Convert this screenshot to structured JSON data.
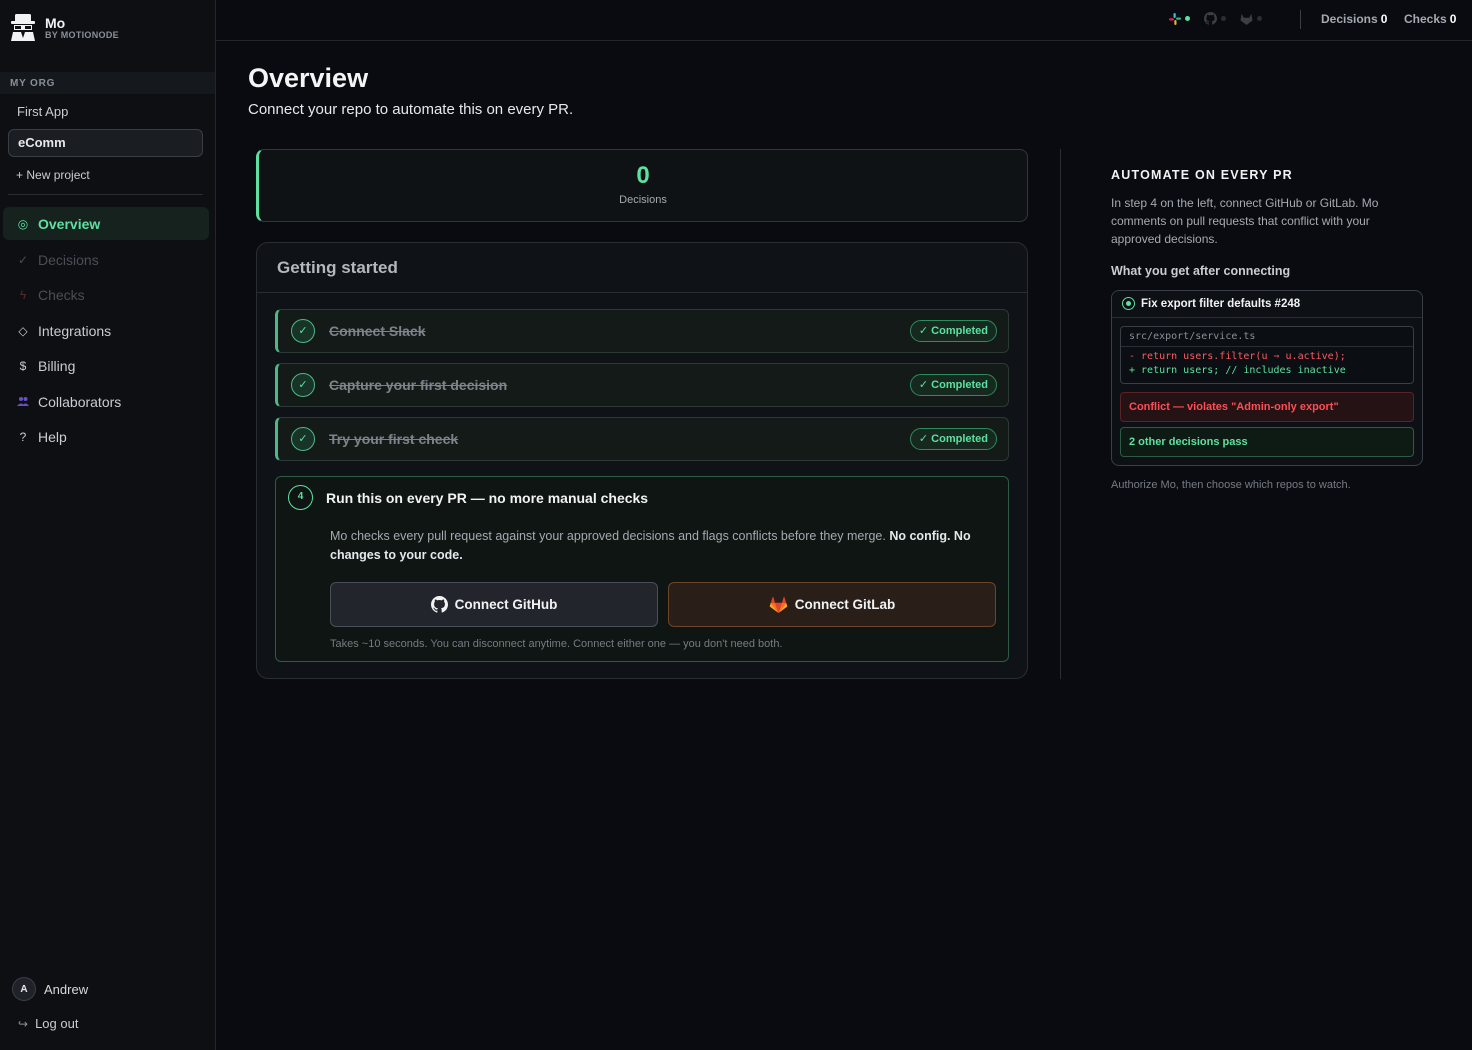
{
  "brand": {
    "name": "Mo",
    "subtitle": "BY MOTIONODE"
  },
  "sidebar": {
    "org_label": "MY ORG",
    "projects": [
      {
        "label": "First App",
        "active": false
      },
      {
        "label": "eComm",
        "active": true
      }
    ],
    "new_project": "New project",
    "nav": [
      {
        "label": "Overview",
        "icon": "overview-icon",
        "state": "active"
      },
      {
        "label": "Decisions",
        "icon": "check-icon",
        "state": "disabled"
      },
      {
        "label": "Checks",
        "icon": "bolt-icon",
        "state": "disabled"
      },
      {
        "label": "Integrations",
        "icon": "diamond-icon",
        "state": "normal"
      },
      {
        "label": "Billing",
        "icon": "dollar-icon",
        "state": "normal"
      },
      {
        "label": "Collaborators",
        "icon": "people-icon",
        "state": "normal"
      },
      {
        "label": "Help",
        "icon": "question-icon",
        "state": "normal"
      }
    ],
    "user": {
      "initial": "A",
      "name": "Andrew"
    },
    "logout": "Log out"
  },
  "topbar": {
    "integrations": [
      {
        "icon": "slack-icon",
        "status": "connected"
      },
      {
        "icon": "github-icon",
        "status": "disconnected"
      },
      {
        "icon": "gitlab-icon",
        "status": "disconnected"
      }
    ],
    "decisions_label": "Decisions",
    "decisions_count": "0",
    "checks_label": "Checks",
    "checks_count": "0"
  },
  "main": {
    "title": "Overview",
    "subtitle": "Connect your repo to automate this on every PR.",
    "stat": {
      "value": "0",
      "label": "Decisions"
    },
    "getting_started": {
      "title": "Getting started",
      "steps": [
        {
          "label": "Connect Slack",
          "badge": "Completed"
        },
        {
          "label": "Capture your first decision",
          "badge": "Completed"
        },
        {
          "label": "Try your first check",
          "badge": "Completed"
        }
      ],
      "step4": {
        "number": "4",
        "title": "Run this on every PR — no more manual checks",
        "desc": "Mo checks every pull request against your approved decisions and flags conflicts before they merge.",
        "desc_bold": "No config. No changes to your code.",
        "github_button": "Connect GitHub",
        "gitlab_button": "Connect GitLab",
        "note": "Takes ~10 seconds. You can disconnect anytime. Connect either one — you don't need both."
      }
    }
  },
  "right_panel": {
    "title": "AUTOMATE ON EVERY PR",
    "desc": "In step 4 on the left, connect GitHub or GitLab. Mo comments on pull requests that conflict with your approved decisions.",
    "subtitle": "What you get after connecting",
    "pr": {
      "title": "Fix export filter defaults #248",
      "file": "src/export/service.ts",
      "removed": "- return users.filter(u ⇒ u.active);",
      "added": "+ return users; // includes inactive",
      "conflict": "Conflict — violates \"Admin-only export\"",
      "pass": "2 other decisions pass"
    },
    "footer": "Authorize Mo, then choose which repos to watch."
  },
  "colors": {
    "accent": "#5ee0a0",
    "danger": "#ff4d55",
    "background": "#090b10"
  }
}
